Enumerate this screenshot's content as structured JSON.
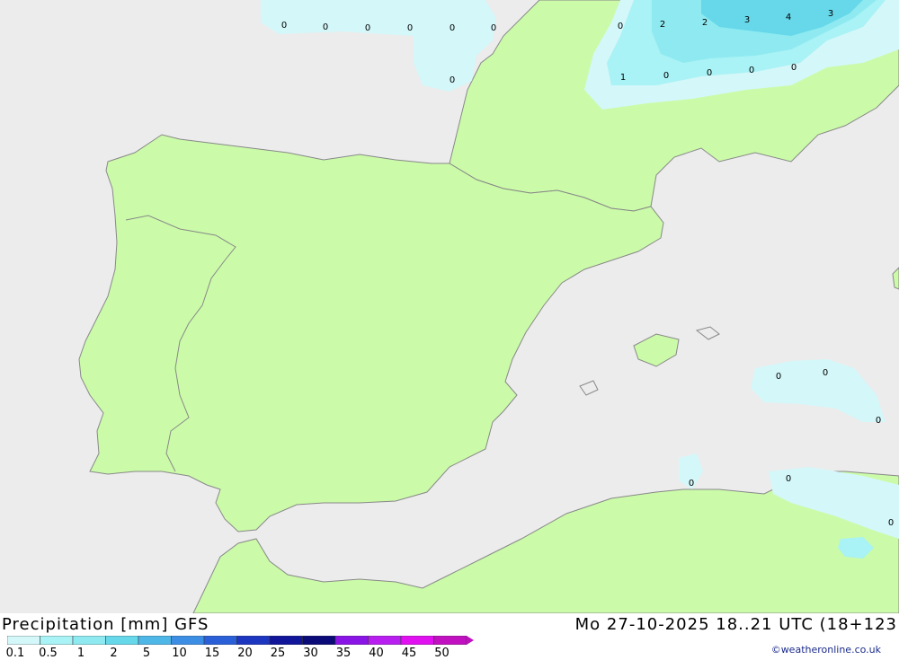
{
  "map": {
    "sea_color": "#ececec",
    "land_color": "#cbfba9",
    "border_color": "#888888",
    "precip_colors": {
      "p0_1": "#d4f7f9",
      "p0_5": "#a9f2f5",
      "p1": "#8eeaf0",
      "p2": "#66d8ea"
    },
    "point_values": [
      "0",
      "0",
      "0",
      "0",
      "0",
      "0",
      "0",
      "0",
      "0",
      "0",
      "0",
      "0",
      "0",
      "0",
      "0",
      "0",
      "0",
      "0",
      "1",
      "2",
      "2",
      "3",
      "4",
      "3"
    ]
  },
  "footer": {
    "title": "Precipitation [mm] GFS",
    "datetime": "Mo 27-10-2025 18..21 UTC (18+123",
    "copyright": "©weatheronline.co.uk"
  },
  "legend": {
    "labels": [
      "0.1",
      "0.5",
      "1",
      "2",
      "5",
      "10",
      "15",
      "20",
      "25",
      "30",
      "35",
      "40",
      "45",
      "50"
    ],
    "colors": [
      "#d4f7f9",
      "#a9f2f5",
      "#8eeaf0",
      "#66d8ea",
      "#4fb6e8",
      "#3c8ee4",
      "#2a5fd8",
      "#1c36c0",
      "#10159a",
      "#0a0a78",
      "#8a14e6",
      "#b81ef0",
      "#e010f0",
      "#c010c0"
    ]
  }
}
